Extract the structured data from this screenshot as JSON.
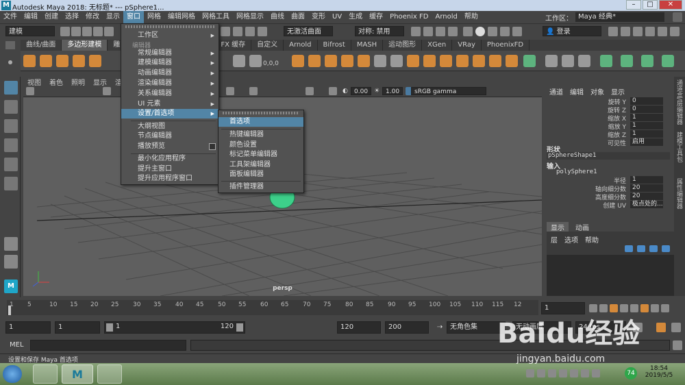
{
  "title_bar": {
    "text": "Autodesk Maya 2018: 无标题*   ---   pSphere1..."
  },
  "menubar": {
    "items": [
      "文件",
      "编辑",
      "创建",
      "选择",
      "修改",
      "显示",
      "窗口",
      "网格",
      "编辑网格",
      "网格工具",
      "网格显示",
      "曲线",
      "曲面",
      "变形",
      "UV",
      "生成",
      "缓存",
      "Phoenix FD",
      "Arnold",
      "帮助"
    ],
    "active_index": 6
  },
  "workspace": {
    "label": "工作区：",
    "value": "Maya 经典*"
  },
  "status_line": {
    "mode": "建模",
    "live_surface": "无激活曲面",
    "symmetry": "对称: 禁用",
    "login": "登录"
  },
  "shelf_tabs": {
    "items": [
      "曲线/曲面",
      "多边形建模",
      "雕刻",
      "FX 缓存",
      "自定义",
      "Arnold",
      "Bifrost",
      "MASH",
      "运动图形",
      "XGen",
      "VRay",
      "PhoenixFD"
    ],
    "active_index": 1
  },
  "shelf": {
    "counter": "0,0,0"
  },
  "viewport": {
    "menu": [
      "视图",
      "着色",
      "照明",
      "显示",
      "渲染"
    ],
    "exposure": "0.00",
    "gamma": "1.00",
    "colorspace": "sRGB gamma",
    "camera_label": "persp"
  },
  "window_menu": {
    "items": [
      "工作区",
      "编辑器",
      "常规编辑器",
      "建模编辑器",
      "动画编辑器",
      "渲染编辑器",
      "关系编辑器",
      "UI 元素",
      "设置/首选项",
      "大纲视图",
      "节点编辑器",
      "播放预览",
      "最小化应用程序",
      "提升主窗口",
      "提升应用程序窗口"
    ]
  },
  "settings_submenu": {
    "items": [
      "首选项",
      "热键编辑器",
      "颜色设置",
      "标记菜单编辑器",
      "工具架编辑器",
      "面板编辑器",
      "插件管理器"
    ]
  },
  "channel_box": {
    "tabs": [
      "通道",
      "编辑",
      "对象",
      "显示"
    ],
    "attrs": [
      {
        "label": "旋转 Y",
        "value": "0"
      },
      {
        "label": "旋转 Z",
        "value": "0"
      },
      {
        "label": "缩放 X",
        "value": "1"
      },
      {
        "label": "缩放 Y",
        "value": "1"
      },
      {
        "label": "缩放 Z",
        "value": "1"
      },
      {
        "label": "可见性",
        "value": "启用"
      }
    ],
    "shape_section": "形状",
    "shape_name": "pSphereShape1",
    "input_section": "输入",
    "input_name": "polySphere1",
    "input_attrs": [
      {
        "label": "半径",
        "value": "1"
      },
      {
        "label": "轴向细分数",
        "value": "20"
      },
      {
        "label": "高度细分数",
        "value": "20"
      },
      {
        "label": "创建 UV",
        "value": "极点处的..."
      }
    ]
  },
  "layer_editor": {
    "tabs": [
      "显示",
      "动画"
    ],
    "menu": [
      "层",
      "选项",
      "帮助"
    ]
  },
  "right_sidebar": {
    "tabs": [
      "通道盒/层编辑器",
      "建模工具包",
      "属性编辑器"
    ]
  },
  "timeline": {
    "ticks": [
      "1",
      "5",
      "10",
      "15",
      "20",
      "25",
      "30",
      "35",
      "40",
      "45",
      "50",
      "55",
      "60",
      "65",
      "70",
      "75",
      "80",
      "85",
      "90",
      "95",
      "100",
      "105",
      "110",
      "115",
      "12"
    ],
    "current_frame": "1"
  },
  "range": {
    "start": "1",
    "anim_start": "1",
    "slider_start": "1",
    "slider_end": "120",
    "end": "120",
    "anim_end": "200",
    "character_set": "无角色集",
    "anim_layer": "无动画层",
    "fps": "24 fps"
  },
  "mel": {
    "label": "MEL"
  },
  "help_line": {
    "text": "设置和保存 Maya 首选项"
  },
  "taskbar": {
    "time": "18:54",
    "date": "2019/5/5",
    "badge": "74"
  },
  "watermark": {
    "text": "Baidu经验",
    "url": "jingyan.baidu.com"
  }
}
